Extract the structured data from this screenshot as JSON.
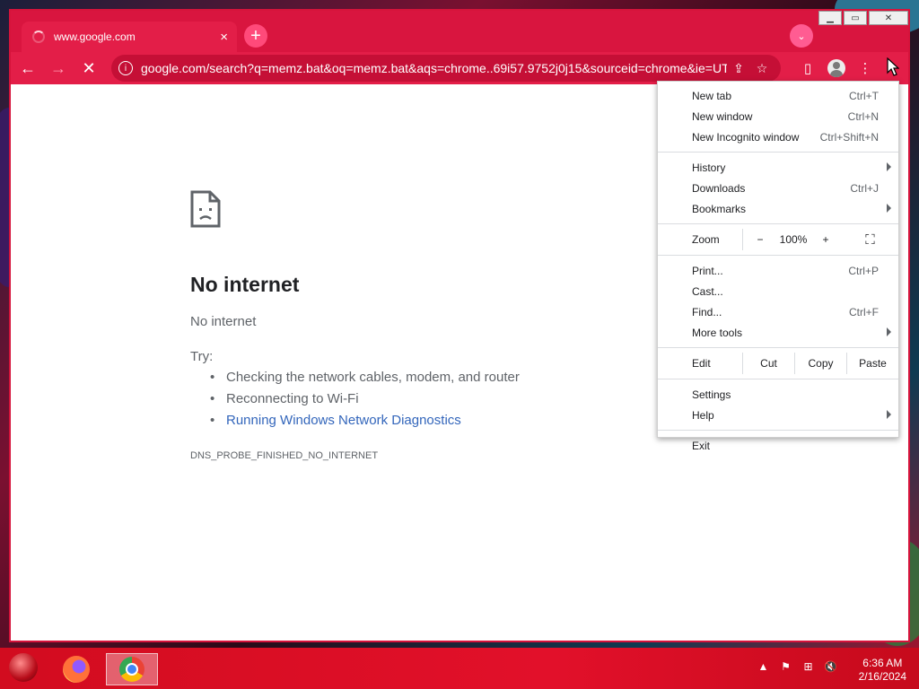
{
  "colors": {
    "accent": "#e31e48",
    "tabstrip": "#d9153f",
    "link": "#3366bb",
    "taskbar": "#d20c1f"
  },
  "tab": {
    "title": "www.google.com",
    "close": "×"
  },
  "new_tab_glyph": "+",
  "tab_search_glyph": "⌄",
  "window_controls": {
    "minimize": "▁",
    "maximize": "▭",
    "close": "✕"
  },
  "toolbar": {
    "back": "←",
    "forward": "→",
    "stop": "✕",
    "url": "google.com/search?q=memz.bat&oq=memz.bat&aqs=chrome..69i57.9752j0j15&sourceid=chrome&ie=UT...",
    "share_glyph": "⇪",
    "star_glyph": "☆",
    "sidepanel_glyph": "▯",
    "menu_glyph": "⋮"
  },
  "error": {
    "title": "No internet",
    "subtitle": "No internet",
    "try_label": "Try:",
    "suggestions": [
      "Checking the network cables, modem, and router",
      "Reconnecting to Wi-Fi",
      "Running Windows Network Diagnostics"
    ],
    "code": "DNS_PROBE_FINISHED_NO_INTERNET"
  },
  "menu": {
    "group1": [
      {
        "label": "New tab",
        "shortcut": "Ctrl+T"
      },
      {
        "label": "New window",
        "shortcut": "Ctrl+N"
      },
      {
        "label": "New Incognito window",
        "shortcut": "Ctrl+Shift+N"
      }
    ],
    "group2": [
      {
        "label": "History",
        "shortcut": ""
      },
      {
        "label": "Downloads",
        "shortcut": "Ctrl+J"
      },
      {
        "label": "Bookmarks",
        "shortcut": ""
      }
    ],
    "zoom": {
      "label": "Zoom",
      "minus": "−",
      "value": "100%",
      "plus": "+",
      "fullscreen": "⛶"
    },
    "group3": [
      {
        "label": "Print...",
        "shortcut": "Ctrl+P"
      },
      {
        "label": "Cast...",
        "shortcut": ""
      },
      {
        "label": "Find...",
        "shortcut": "Ctrl+F"
      },
      {
        "label": "More tools",
        "shortcut": ""
      }
    ],
    "edit": {
      "label": "Edit",
      "cut": "Cut",
      "copy": "Copy",
      "paste": "Paste"
    },
    "group4": [
      {
        "label": "Settings",
        "shortcut": ""
      },
      {
        "label": "Help",
        "shortcut": ""
      }
    ],
    "exit": "Exit"
  },
  "taskbar": {
    "tray_glyphs": [
      "▲",
      "⚑",
      "⊞",
      "🔇"
    ],
    "time": "6:36 AM",
    "date": "2/16/2024"
  }
}
